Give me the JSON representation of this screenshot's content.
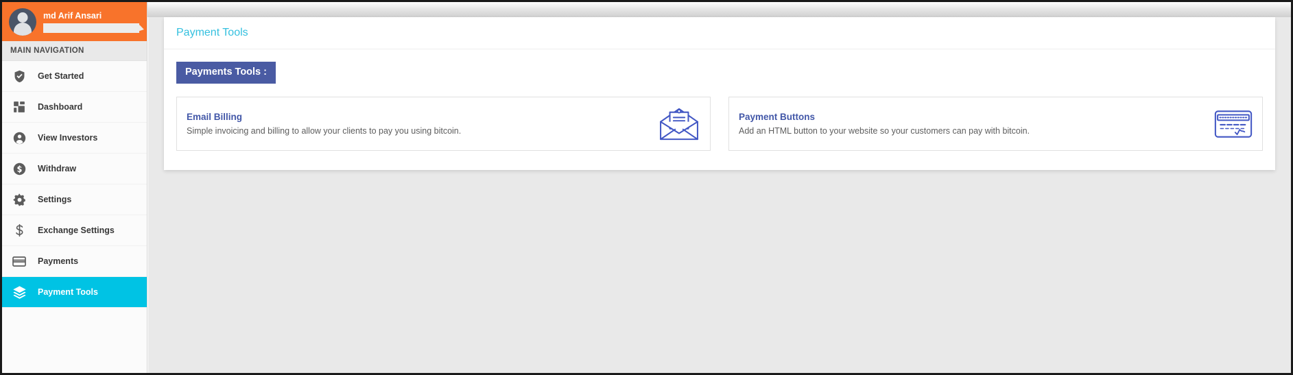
{
  "sidebar": {
    "user": {
      "name": "md Arif Ansari",
      "avatar_icon": "user-avatar-icon",
      "status_bar_value": ""
    },
    "nav_heading": "MAIN NAVIGATION",
    "items": [
      {
        "label": "Get Started",
        "icon": "shield-check-icon",
        "active": false
      },
      {
        "label": "Dashboard",
        "icon": "dashboard-grid-icon",
        "active": false
      },
      {
        "label": "View Investors",
        "icon": "user-circle-icon",
        "active": false
      },
      {
        "label": "Withdraw",
        "icon": "dollar-circle-icon",
        "active": false
      },
      {
        "label": "Settings",
        "icon": "gear-icon",
        "active": false
      },
      {
        "label": "Exchange Settings",
        "icon": "dollar-sign-icon",
        "active": false
      },
      {
        "label": "Payments",
        "icon": "credit-card-icon",
        "active": false
      },
      {
        "label": "Payment Tools",
        "icon": "layers-icon",
        "active": true
      }
    ]
  },
  "main": {
    "page_title": "Payment Tools",
    "section_badge": "Payments Tools :",
    "cards": [
      {
        "title": "Email Billing",
        "description": "Simple invoicing and billing to allow your clients to pay you using bitcoin.",
        "icon": "open-envelope-letter-icon"
      },
      {
        "title": "Payment Buttons",
        "description": "Add an HTML button to your website so your customers can pay with bitcoin.",
        "icon": "credit-card-signature-icon"
      }
    ]
  },
  "colors": {
    "sidebar_user_bg": "#f8732b",
    "active_nav_bg": "#00c3e4",
    "page_title": "#34c0df",
    "badge_bg": "#4a5ba3",
    "card_title": "#4257a8",
    "card_icon": "#4257c4",
    "page_bg": "#e9e9e9"
  }
}
